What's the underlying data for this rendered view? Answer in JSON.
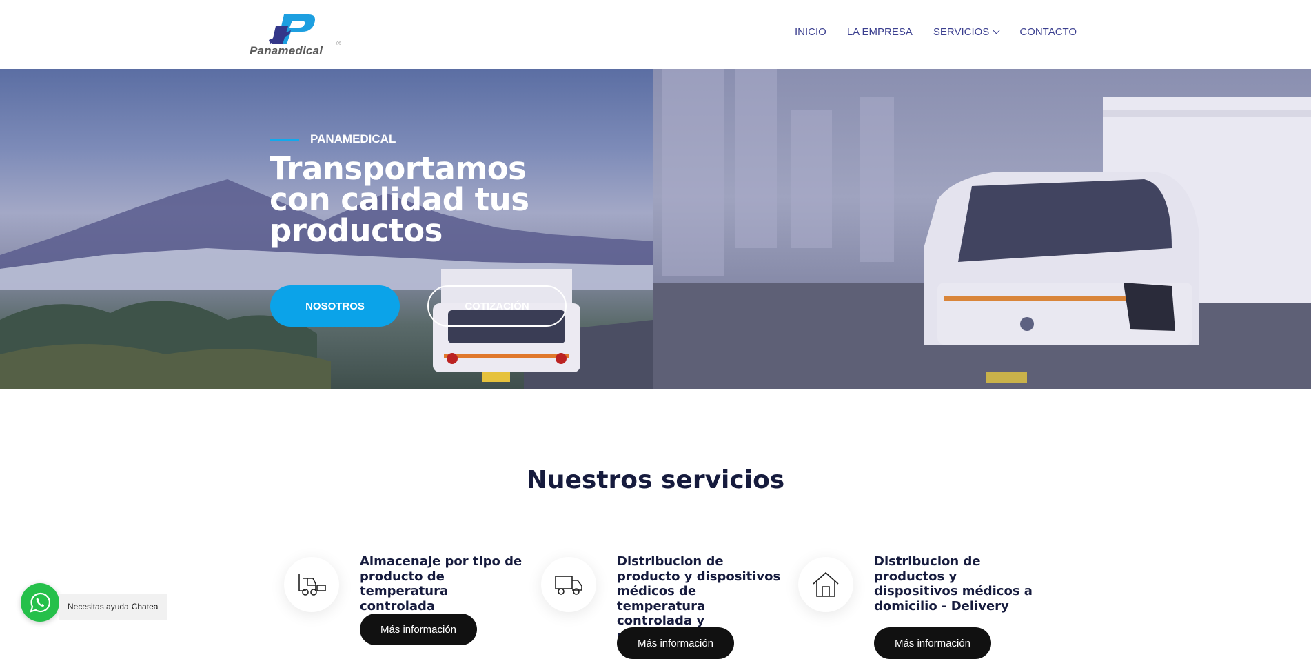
{
  "header": {
    "logo_text": "Panamedical",
    "logo_reg": "®",
    "nav": [
      {
        "label": "INICIO"
      },
      {
        "label": "LA EMPRESA"
      },
      {
        "label": "SERVICIOS"
      },
      {
        "label": "CONTACTO"
      }
    ]
  },
  "hero": {
    "eyebrow": "PANAMEDICAL",
    "title": "Transportamos con calidad tus productos",
    "btn_primary": "NOSOTROS",
    "btn_secondary": "COTIZACIÓN"
  },
  "services": {
    "title": "Nuestros servicios",
    "items": [
      {
        "icon": "forklift-icon",
        "title": "Almacenaje por tipo de producto de temperatura controlada",
        "button": "Más información"
      },
      {
        "icon": "truck-icon",
        "title": "Distribucion de producto y dispositivos médicos de temperatura controlada y refrigerada",
        "button": "Más información"
      },
      {
        "icon": "house-icon",
        "title": "Distribucion de productos y dispositivos médicos a domicilio - Delivery",
        "button": "Más información"
      }
    ]
  },
  "whatsapp": {
    "tip_prefix": "Necesitas ayuda",
    "tip_action": "Chatea"
  },
  "colors": {
    "brand_blue": "#3b3f8f",
    "accent": "#0ba3e9",
    "heading": "#161b3d",
    "whatsapp": "#25c04a"
  }
}
